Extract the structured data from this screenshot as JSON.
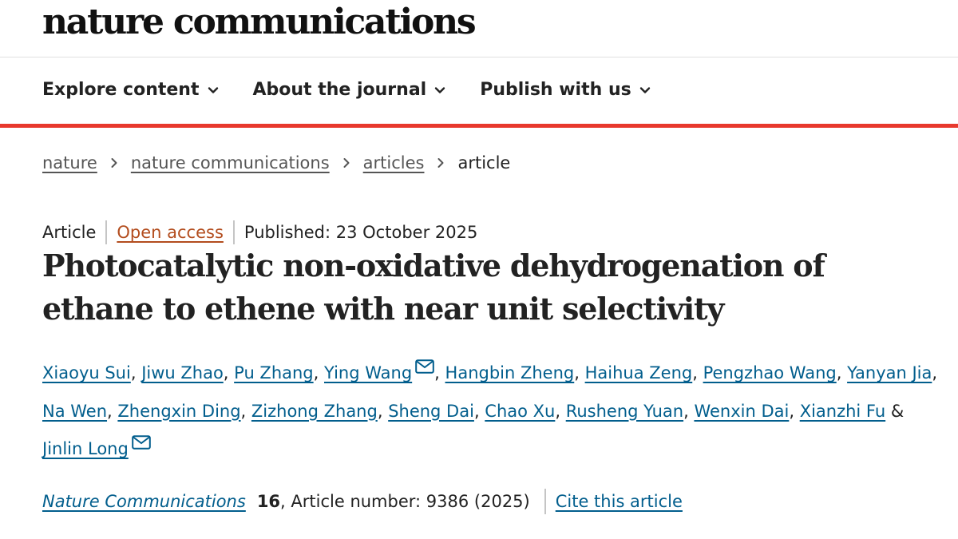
{
  "brand": {
    "name": "nature communications"
  },
  "nav": {
    "items": [
      {
        "label": "Explore content"
      },
      {
        "label": "About the journal"
      },
      {
        "label": "Publish with us"
      }
    ]
  },
  "breadcrumb": {
    "items": [
      "nature",
      "nature communications",
      "articles"
    ],
    "current": "article"
  },
  "article": {
    "type": "Article",
    "access": "Open access",
    "published": "Published: 23 October 2025",
    "title": "Photocatalytic non-oxidative dehydrogenation of ethane to ethene with near unit selectivity",
    "authors": [
      "Xiaoyu Sui",
      "Jiwu Zhao",
      "Pu Zhang",
      "Ying Wang",
      "Hangbin Zheng",
      "Haihua Zeng",
      "Pengzhao Wang",
      "Yanyan Jia",
      "Na Wen",
      "Zhengxin Ding",
      "Zizhong Zhang",
      "Sheng Dai",
      "Chao Xu",
      "Rusheng Yuan",
      "Wenxin Dai",
      "Xianzhi Fu",
      "Jinlin Long"
    ],
    "authors_and": "&",
    "citation": {
      "journal": "Nature Communications",
      "volume": "16",
      "rest": ", Article number: 9386 (2025)",
      "cite_label": "Cite this article"
    }
  },
  "colors": {
    "accent": "#e8382d",
    "link": "#025e8d",
    "open_access": "#b34d1e"
  }
}
